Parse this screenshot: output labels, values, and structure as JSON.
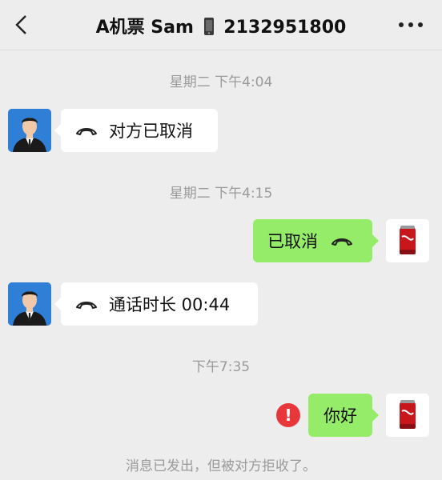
{
  "header": {
    "title_prefix": "A机票 Sam",
    "title_number": "2132951800",
    "back_icon": "chevron-left-icon",
    "more_icon": "more-dots-icon"
  },
  "messages": [
    {
      "type": "time",
      "text": "星期二 下午4:04"
    },
    {
      "type": "incoming",
      "icon": "phone-hangup-icon",
      "text": "对方已取消"
    },
    {
      "type": "time",
      "text": "星期二 下午4:15"
    },
    {
      "type": "outgoing",
      "icon": "phone-hangup-icon",
      "text": "已取消"
    },
    {
      "type": "incoming",
      "icon": "phone-hangup-icon",
      "text": "通话时长 00:44"
    },
    {
      "type": "time",
      "text": "下午7:35"
    },
    {
      "type": "outgoing",
      "status": "failed",
      "text": "你好"
    }
  ],
  "error_icon": "!",
  "notice": "消息已发出，但被对方拒收了。",
  "colors": {
    "background": "#ededed",
    "outgoing_bubble": "#95ec69",
    "incoming_bubble": "#ffffff",
    "error": "#e8373a",
    "timestamp": "#9a9a9a"
  }
}
